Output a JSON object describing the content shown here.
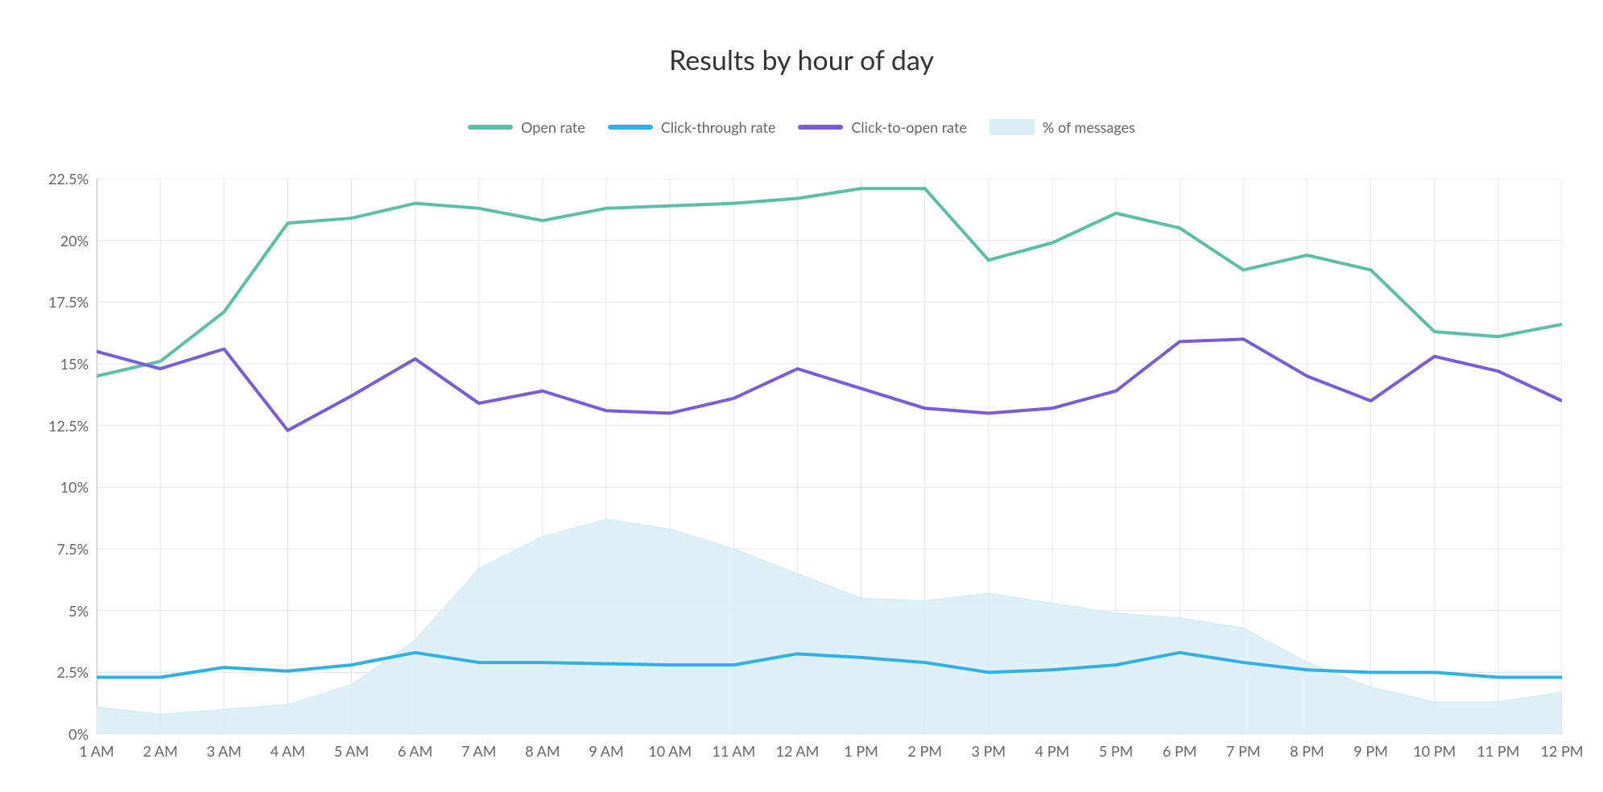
{
  "title": "Results by hour of day",
  "legend": {
    "open_rate": "Open rate",
    "ctr": "Click-through rate",
    "cto": "Click-to-open rate",
    "pct_messages": "% of messages"
  },
  "colors": {
    "open_rate": "#5bbfa8",
    "ctr": "#2fb1e6",
    "cto": "#7a5bd8",
    "pct_messages_fill": "#d9eef6",
    "pct_messages_stroke": "#cde7f1"
  },
  "chart_data": {
    "type": "line",
    "xlabel": "",
    "ylabel": "",
    "ylim": [
      0,
      22.5
    ],
    "yticks": [
      0,
      2.5,
      5,
      7.5,
      10,
      12.5,
      15,
      17.5,
      20,
      22.5
    ],
    "ytick_labels": [
      "0%",
      "2.5%",
      "5%",
      "7.5%",
      "10%",
      "12.5%",
      "15%",
      "17.5%",
      "20%",
      "22.5%"
    ],
    "categories": [
      "1 AM",
      "2 AM",
      "3 AM",
      "4 AM",
      "5 AM",
      "6 AM",
      "7 AM",
      "8 AM",
      "9 AM",
      "10 AM",
      "11 AM",
      "12 AM",
      "1 PM",
      "2 PM",
      "3 PM",
      "4 PM",
      "5 PM",
      "6 PM",
      "7 PM",
      "8 PM",
      "9 PM",
      "10 PM",
      "11 PM",
      "12 PM"
    ],
    "series": [
      {
        "name": "Open rate",
        "key": "open_rate",
        "style": "line",
        "values": [
          14.5,
          15.1,
          17.1,
          20.7,
          20.9,
          21.5,
          21.3,
          20.8,
          21.3,
          21.4,
          21.5,
          21.7,
          22.1,
          22.1,
          19.2,
          19.9,
          21.1,
          20.5,
          18.8,
          19.4,
          18.8,
          16.3,
          16.1,
          16.6
        ]
      },
      {
        "name": "Click-through rate",
        "key": "ctr",
        "style": "line",
        "values": [
          2.3,
          2.3,
          2.7,
          2.55,
          2.8,
          3.3,
          2.9,
          2.9,
          2.85,
          2.8,
          2.8,
          3.25,
          3.1,
          2.9,
          2.5,
          2.6,
          2.8,
          3.3,
          2.9,
          2.6,
          2.5,
          2.5,
          2.3,
          2.3
        ]
      },
      {
        "name": "Click-to-open rate",
        "key": "cto",
        "style": "line",
        "values": [
          15.5,
          14.8,
          15.6,
          12.3,
          13.7,
          15.2,
          13.4,
          13.9,
          13.1,
          13.0,
          13.6,
          14.8,
          14.0,
          13.2,
          13.0,
          13.2,
          13.9,
          15.9,
          16.0,
          14.5,
          13.5,
          15.3,
          14.7,
          13.5
        ]
      },
      {
        "name": "% of messages",
        "key": "pct_messages",
        "style": "area",
        "values": [
          1.1,
          0.8,
          1.0,
          1.2,
          2.0,
          3.8,
          6.7,
          8.0,
          8.7,
          8.3,
          7.5,
          6.5,
          5.5,
          5.4,
          5.7,
          5.3,
          4.9,
          4.7,
          4.3,
          2.9,
          1.9,
          1.3,
          1.3,
          1.7
        ]
      }
    ]
  }
}
